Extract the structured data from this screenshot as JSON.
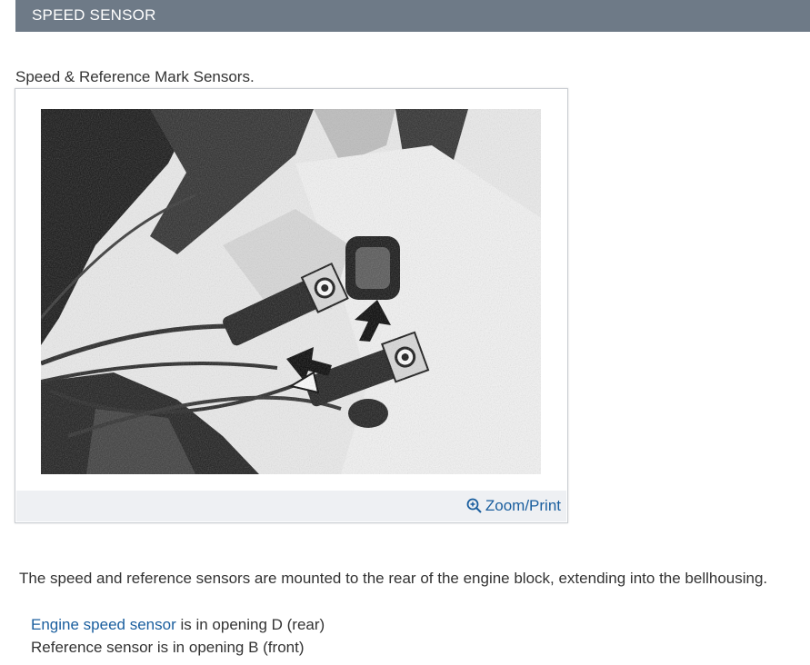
{
  "header": {
    "title": "SPEED SENSOR"
  },
  "figure": {
    "caption": "Speed & Reference Mark Sensors.",
    "zoom_label": "Zoom/Print"
  },
  "body": {
    "paragraph": "The speed and reference sensors are mounted to the rear of the engine block, extending into the bellhousing.",
    "line1_link": "Engine speed sensor",
    "line1_rest": " is in opening D (rear)",
    "line2": "Reference sensor is in opening B (front)"
  },
  "colors": {
    "header_bg": "#6e7a87",
    "link": "#1a5e9e",
    "footer_bg": "#eef0f3"
  }
}
